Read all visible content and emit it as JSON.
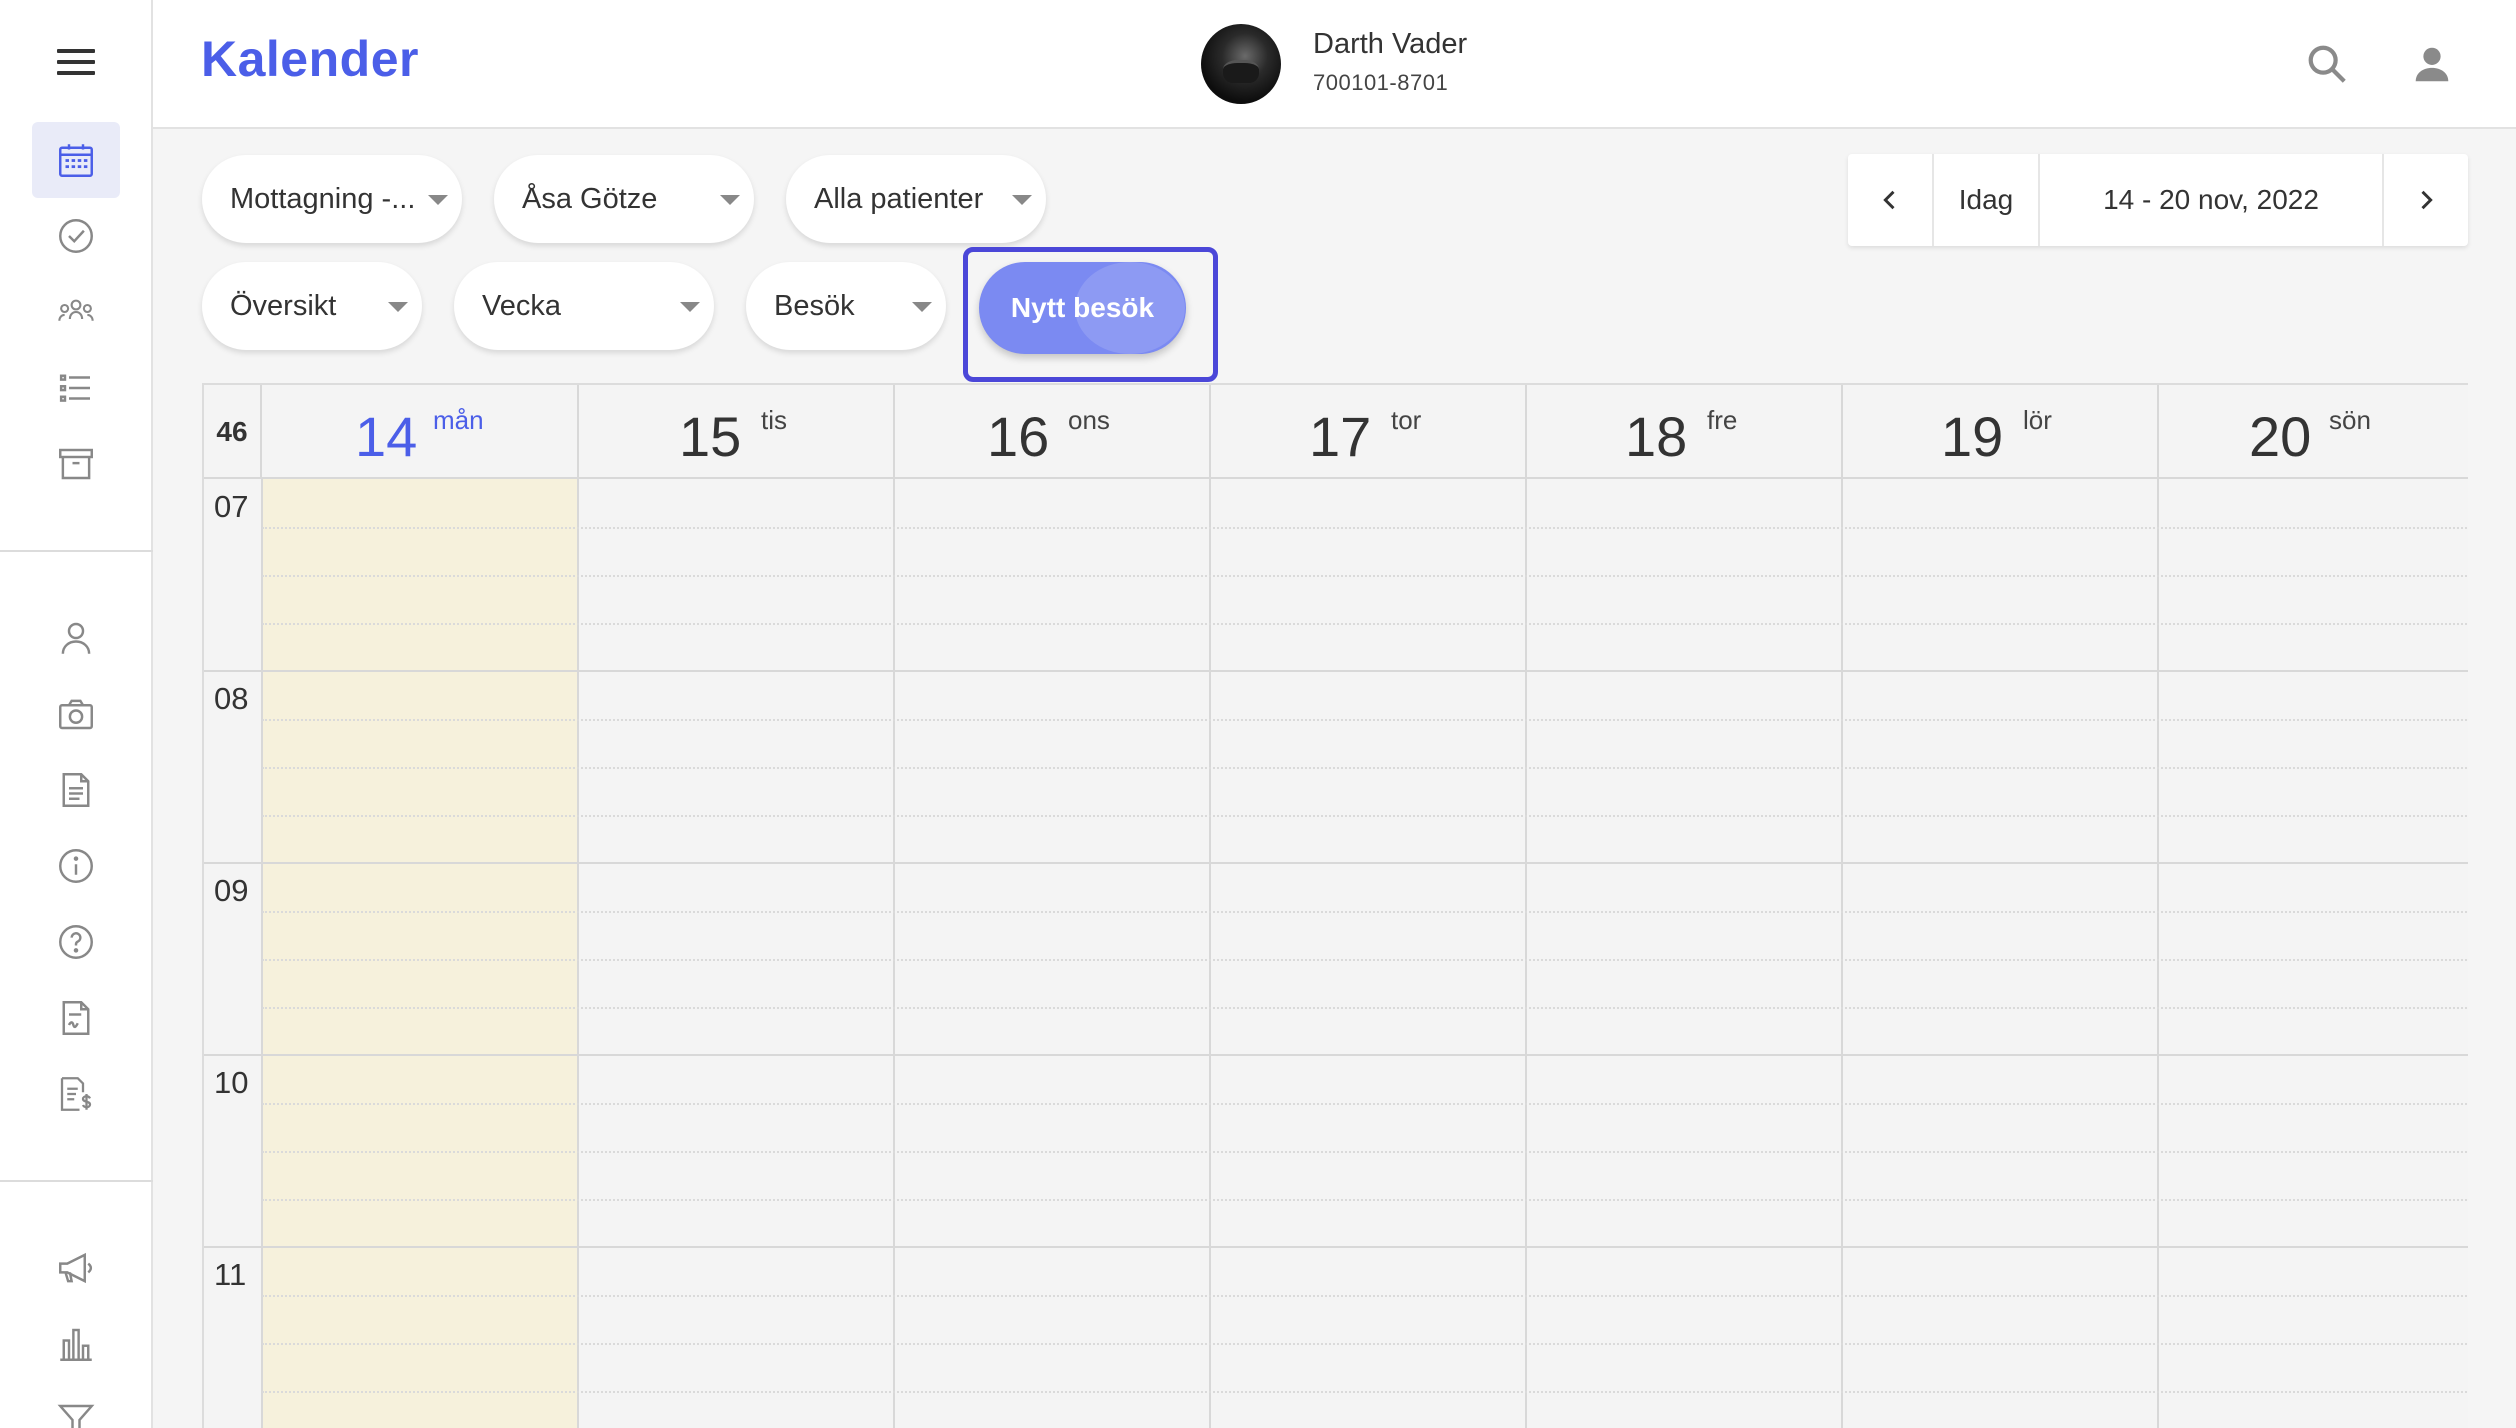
{
  "app": {
    "title": "Kalender"
  },
  "patient": {
    "name": "Darth Vader",
    "id": "700101-8701"
  },
  "filters": {
    "clinic": "Mottagning -...",
    "practitioner": "Åsa Götze",
    "patients": "Alla patienter",
    "view": "Översikt",
    "period": "Vecka",
    "type": "Besök"
  },
  "actions": {
    "new_visit": "Nytt besök"
  },
  "date_nav": {
    "today": "Idag",
    "range": "14 - 20 nov, 2022"
  },
  "calendar": {
    "week_number": "46",
    "days": [
      {
        "num": "14",
        "name": "mån",
        "today": true
      },
      {
        "num": "15",
        "name": "tis"
      },
      {
        "num": "16",
        "name": "ons"
      },
      {
        "num": "17",
        "name": "tor"
      },
      {
        "num": "18",
        "name": "fre"
      },
      {
        "num": "19",
        "name": "lör"
      },
      {
        "num": "20",
        "name": "sön"
      }
    ],
    "hours": [
      "07",
      "08",
      "09",
      "10",
      "11"
    ]
  },
  "colors": {
    "accent": "#4b5ee8",
    "button": "#7b8af2",
    "today_bg": "#f6f1dc",
    "focus_frame": "#4b47d8"
  },
  "icons": {
    "sidebar_top": [
      "calendar-icon",
      "check-circle-icon",
      "group-icon",
      "list-icon",
      "archive-icon"
    ],
    "sidebar_mid": [
      "person-icon",
      "camera-icon",
      "document-icon",
      "info-icon",
      "help-icon",
      "signed-document-icon",
      "invoice-icon"
    ],
    "sidebar_bottom": [
      "megaphone-icon",
      "bar-chart-icon",
      "filter-icon"
    ],
    "header": [
      "search-icon",
      "account-icon"
    ]
  }
}
